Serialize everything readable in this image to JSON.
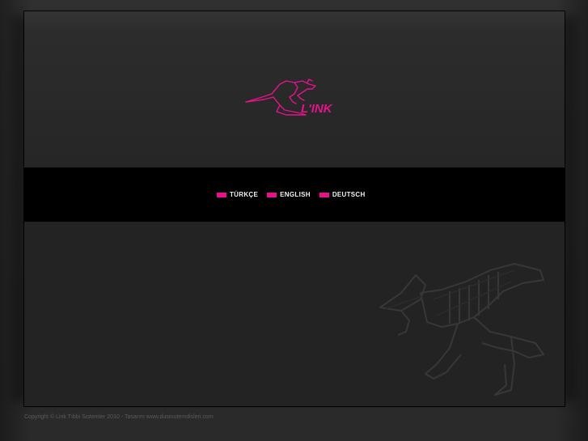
{
  "brand": {
    "logo_text": "L'INK",
    "logo_icon": "kangaroo-icon",
    "accent_color": "#e6128c"
  },
  "languages": [
    {
      "label": "TÜRKÇE"
    },
    {
      "label": "ENGLISH"
    },
    {
      "label": "DEUTSCH"
    }
  ],
  "footer": {
    "copyright": "Copyright © Link Tıbbi Sistemler 2010 - Tasarım www.dusmutemdisleri.com"
  }
}
